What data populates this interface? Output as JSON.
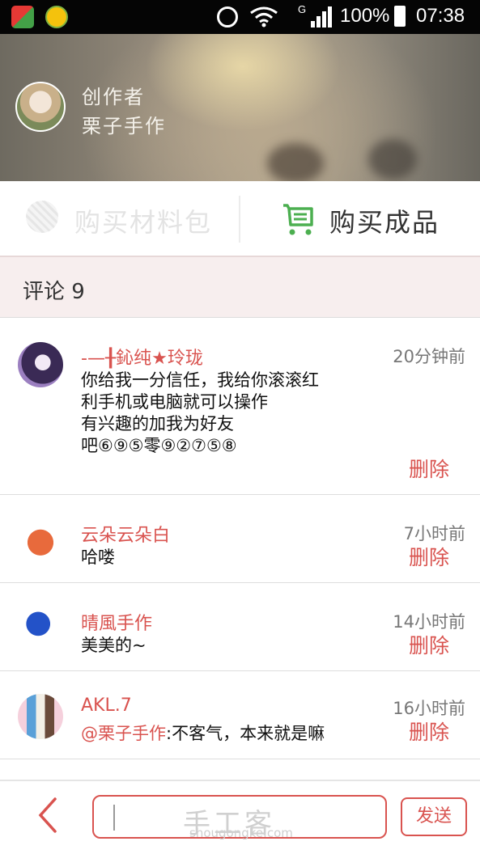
{
  "status_bar": {
    "network_label": "G",
    "battery": "100%",
    "time": "07:38"
  },
  "creator": {
    "role": "创作者",
    "name": "栗子手作"
  },
  "buy": {
    "materials_label": "购买材料包",
    "finished_label": "购买成品"
  },
  "comments_header": {
    "title": "评论 9"
  },
  "comments": [
    {
      "user": "-—╂鈊纯★玲珑",
      "time": "20分钟前",
      "body": "你给我一分信任，我给你滚滚红\n利手机或电脑就可以操作\n有兴趣的加我为好友\n吧⑥⑨⑤零⑨②⑦⑤⑧",
      "delete_label": "删除"
    },
    {
      "user": "云朵云朵白",
      "time": "7小时前",
      "body": "哈喽",
      "delete_label": "删除"
    },
    {
      "user": "晴風手作",
      "time": "14小时前",
      "body": "美美的~",
      "delete_label": "删除"
    },
    {
      "user": "AKL.7",
      "time": "16小时前",
      "mention": "@栗子手作",
      "body": ":不客气，本来就是嘛",
      "delete_label": "删除"
    }
  ],
  "bottom_bar": {
    "input_watermark": "手工客",
    "input_watermark_sub": "shougongke.com",
    "send_label": "发送"
  },
  "colors": {
    "accent": "#d9534f",
    "cart_green": "#4caf50",
    "comments_header_bg": "#f7eeee"
  }
}
